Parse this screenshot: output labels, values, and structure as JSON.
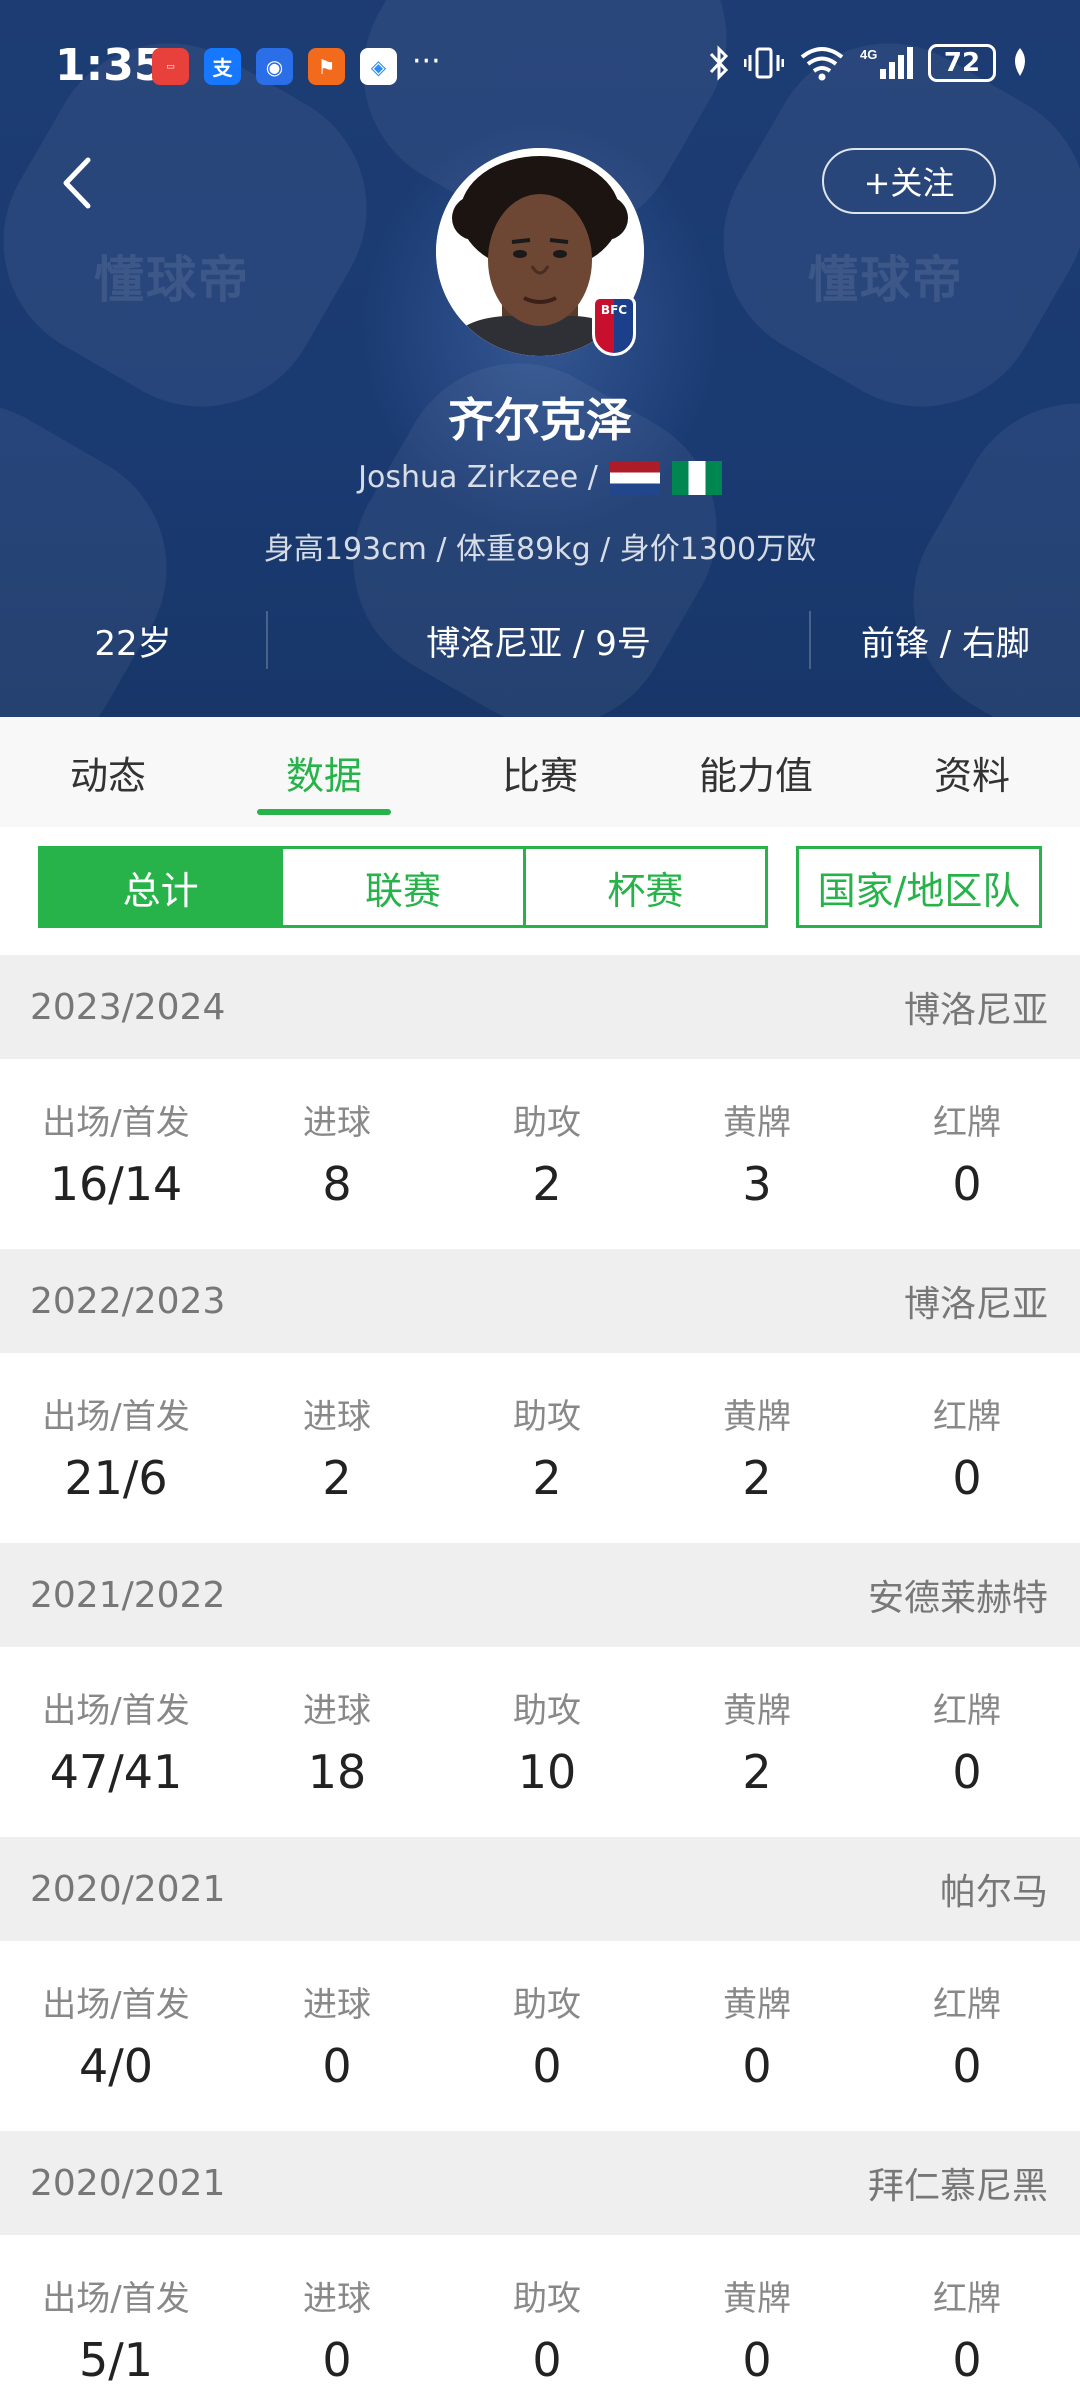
{
  "status_bar": {
    "time": "1:35",
    "battery": "72",
    "more": "···"
  },
  "header": {
    "follow_label": "+关注",
    "watermark": "懂球帝",
    "club_badge_text": "BFC"
  },
  "player": {
    "name_cn": "齐尔克泽",
    "name_en": "Joshua Zirkzee /",
    "body_info": "身高193cm / 体重89kg / 身价1300万欧",
    "age": "22岁",
    "club_number": "博洛尼亚 / 9号",
    "position_foot": "前锋 / 右脚"
  },
  "tabs": [
    "动态",
    "数据",
    "比赛",
    "能力值",
    "资料"
  ],
  "active_tab": 1,
  "segments": {
    "total": "总计",
    "league": "联赛",
    "cup": "杯赛",
    "national": "国家/地区队"
  },
  "stat_labels": {
    "apps": "出场/首发",
    "goals": "进球",
    "assists": "助攻",
    "yellow": "黄牌",
    "red": "红牌"
  },
  "seasons": [
    {
      "season": "2023/2024",
      "club": "博洛尼亚",
      "apps": "16/14",
      "goals": "8",
      "assists": "2",
      "yellow": "3",
      "red": "0"
    },
    {
      "season": "2022/2023",
      "club": "博洛尼亚",
      "apps": "21/6",
      "goals": "2",
      "assists": "2",
      "yellow": "2",
      "red": "0"
    },
    {
      "season": "2021/2022",
      "club": "安德莱赫特",
      "apps": "47/41",
      "goals": "18",
      "assists": "10",
      "yellow": "2",
      "red": "0"
    },
    {
      "season": "2020/2021",
      "club": "帕尔马",
      "apps": "4/0",
      "goals": "0",
      "assists": "0",
      "yellow": "0",
      "red": "0"
    },
    {
      "season": "2020/2021",
      "club": "拜仁慕尼黑",
      "apps": "5/1",
      "goals": "0",
      "assists": "0",
      "yellow": "0",
      "red": "0"
    }
  ],
  "colors": {
    "header_bg": "#1b3a70",
    "accent_green": "#27b34a"
  }
}
